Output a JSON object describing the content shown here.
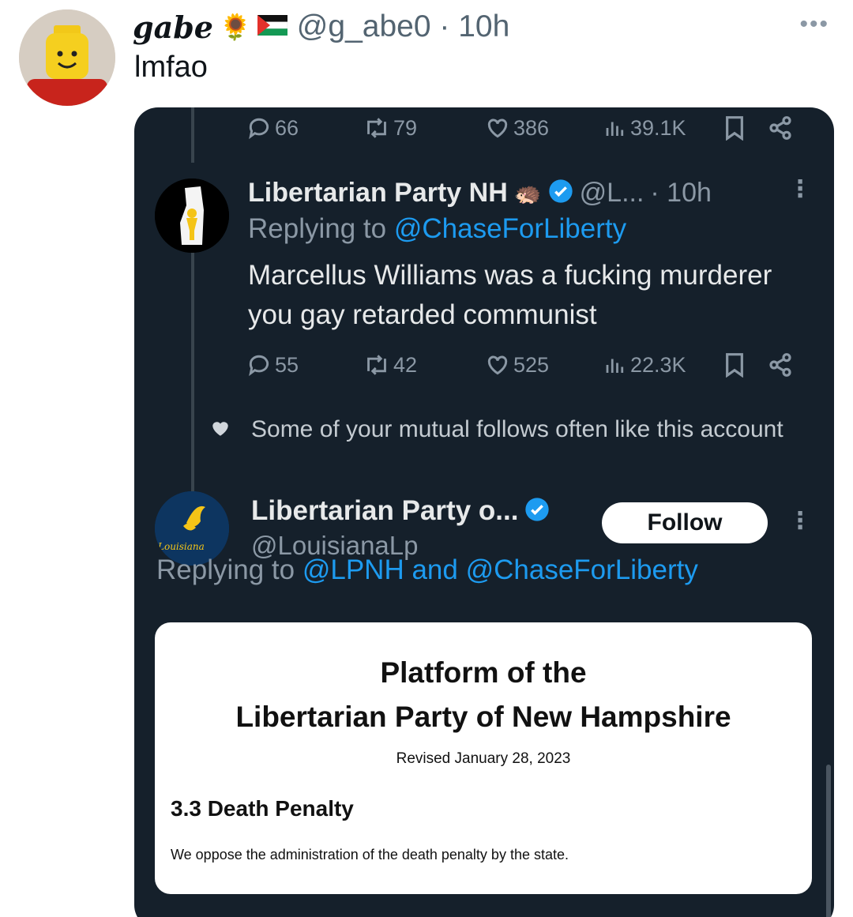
{
  "tweet": {
    "display_name": "gabe",
    "name_emoji": "🌻",
    "handle": "@g_abe0",
    "separator": "·",
    "time": "10h",
    "more": "•••",
    "text": "lmfao"
  },
  "quoted": {
    "top_actions": {
      "replies": "66",
      "reposts": "79",
      "likes": "386",
      "views": "39.1K"
    },
    "reply": {
      "name": "Libertarian Party NH",
      "name_emoji": "🦔",
      "handle": "@L...",
      "time": "· 10h",
      "replying_prefix": "Replying to ",
      "replying_to": "@ChaseForLiberty",
      "text": "Marcellus Williams was a fucking murderer you gay retarded communist",
      "actions": {
        "replies": "55",
        "reposts": "42",
        "likes": "525",
        "views": "22.3K"
      }
    },
    "mutual_note": "Some of your mutual follows often like this account",
    "second": {
      "name": "Libertarian Party o...",
      "handle": "@LouisianaLp",
      "follow_label": "Follow",
      "replying_prefix": "Replying to ",
      "replying_to_1": "@LPNH",
      "replying_and": " and ",
      "replying_to_2": "@ChaseForLiberty",
      "avatar_text": "Louisiana"
    },
    "document": {
      "title_line1": "Platform of the",
      "title_line2": "Libertarian Party of New Hampshire",
      "revised": "Revised January 28, 2023",
      "section": "3.3 Death Penalty",
      "body": "We oppose the administration of the death penalty by the state."
    }
  },
  "colors": {
    "card_bg": "#15202b",
    "link": "#1d9bf0",
    "muted": "#8b98a5",
    "verified": "#1d9bf0"
  }
}
